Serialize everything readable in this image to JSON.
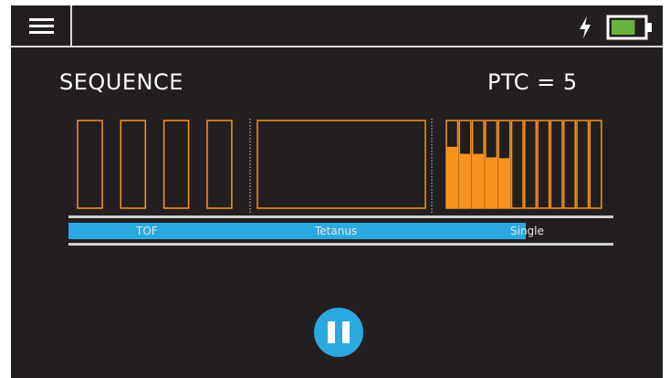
{
  "header": {
    "menu_icon": "hamburger-menu-icon",
    "charging_icon": "lightning-bolt-icon",
    "battery_icon": "battery-icon",
    "battery_level": 0.75,
    "battery_color": "#6ab23e"
  },
  "main": {
    "title": "SEQUENCE",
    "ptc_label": "PTC = 5"
  },
  "sequence": {
    "phases": [
      "TOF",
      "Tetanus",
      "Single"
    ],
    "tof_pulses": 4,
    "tetanus_pulses": 1,
    "single_pulses": 12,
    "single_responses": [
      0.7,
      0.62,
      0.62,
      0.58,
      0.57,
      0,
      0,
      0,
      0,
      0,
      0,
      0
    ],
    "progress": 0.84,
    "pulse_color": "#f7931e",
    "progress_color": "#2ba8e0"
  },
  "controls": {
    "pause_icon": "pause-icon"
  }
}
